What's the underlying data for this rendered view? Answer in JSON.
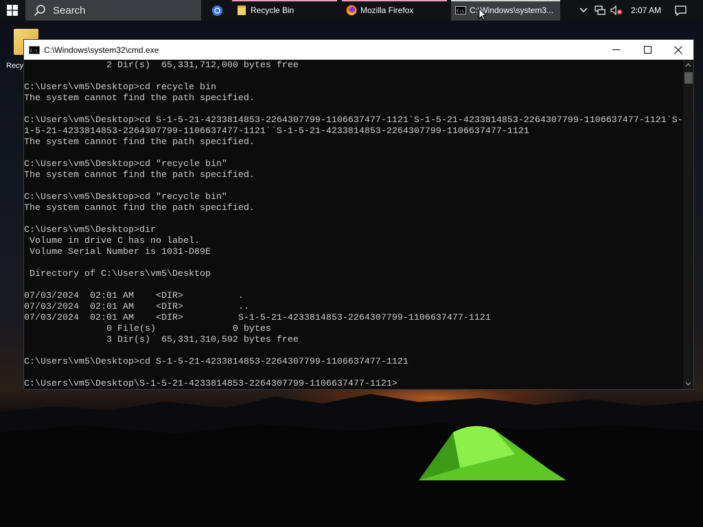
{
  "taskbar": {
    "search_placeholder": "Search",
    "apps": [
      {
        "label": "Recycle Bin"
      },
      {
        "label": "Mozilla Firefox"
      },
      {
        "label": "C:\\Windows\\system3..."
      }
    ],
    "clock": "2:07 AM"
  },
  "desktop": {
    "recycle_label": "Recy"
  },
  "cmd": {
    "title": "C:\\Windows\\system32\\cmd.exe",
    "lines": [
      "               2 Dir(s)  65,331,712,000 bytes free",
      "",
      "C:\\Users\\vm5\\Desktop>cd recycle bin",
      "The system cannot find the path specified.",
      "",
      "C:\\Users\\vm5\\Desktop>cd S-1-5-21-4233814853-2264307799-1106637477-1121`S-1-5-21-4233814853-2264307799-1106637477-1121`S-",
      "1-5-21-4233814853-2264307799-1106637477-1121``S-1-5-21-4233814853-2264307799-1106637477-1121",
      "The system cannot find the path specified.",
      "",
      "C:\\Users\\vm5\\Desktop>cd \"recycle bin\"",
      "The system cannot find the path specified.",
      "",
      "C:\\Users\\vm5\\Desktop>cd \"recycle bin\"",
      "The system cannot find the path specified.",
      "",
      "C:\\Users\\vm5\\Desktop>dir",
      " Volume in drive C has no label.",
      " Volume Serial Number is 1031-D89E",
      "",
      " Directory of C:\\Users\\vm5\\Desktop",
      "",
      "07/03/2024  02:01 AM    <DIR>          .",
      "07/03/2024  02:01 AM    <DIR>          ..",
      "07/03/2024  02:01 AM    <DIR>          S-1-5-21-4233814853-2264307799-1106637477-1121",
      "               0 File(s)              0 bytes",
      "               3 Dir(s)  65,331,310,592 bytes free",
      "",
      "C:\\Users\\vm5\\Desktop>cd S-1-5-21-4233814853-2264307799-1106637477-1121",
      "",
      "C:\\Users\\vm5\\Desktop\\S-1-5-21-4233814853-2264307799-1106637477-1121>"
    ]
  },
  "colors": {
    "console_bg": "#0c0c0c",
    "console_fg": "#cccccc",
    "taskbar_bg": "#101216",
    "tent": "#7be032"
  }
}
